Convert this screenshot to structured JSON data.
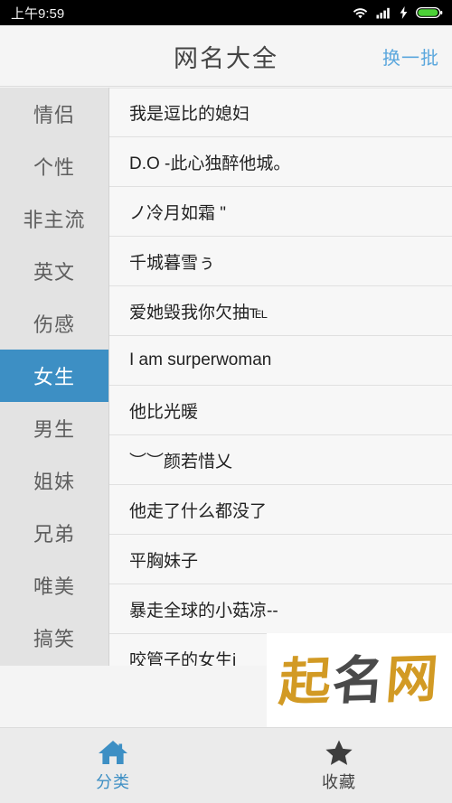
{
  "statusbar": {
    "time": "上午9:59",
    "icons": [
      "wifi-icon",
      "cellular-signal-icon",
      "charging-bolt-icon",
      "battery-icon"
    ],
    "battery_color": "#4cd137",
    "background": "#000000"
  },
  "header": {
    "title": "网名大全",
    "action_label": "换一批",
    "action_color": "#5ba7dd",
    "background": "#f5f5f5"
  },
  "sidebar": {
    "active_index": 5,
    "active_color": "#3d8fc4",
    "background": "#e3e3e3",
    "items": [
      {
        "label": "情侣"
      },
      {
        "label": "个性"
      },
      {
        "label": "非主流"
      },
      {
        "label": "英文"
      },
      {
        "label": "伤感"
      },
      {
        "label": "女生"
      },
      {
        "label": "男生"
      },
      {
        "label": "姐妹"
      },
      {
        "label": "兄弟"
      },
      {
        "label": "唯美"
      },
      {
        "label": "搞笑"
      }
    ]
  },
  "list": {
    "items": [
      {
        "name": "我是逗比的媳妇"
      },
      {
        "name": "D.O -此心独醉他城。"
      },
      {
        "name": "ノ冷月如霜 \""
      },
      {
        "name": "千城暮雪ぅ"
      },
      {
        "name": "爱她毁我你欠抽℡"
      },
      {
        "name": "I am surperwoman"
      },
      {
        "name": "他比光暖"
      },
      {
        "name": "︶︶颜若惜乂"
      },
      {
        "name": "他走了什么都没了"
      },
      {
        "name": "平胸妹子"
      },
      {
        "name": "暴走全球的小菇凉--"
      },
      {
        "name": "咬管子的女生i"
      }
    ]
  },
  "watermark": {
    "char1": "起",
    "char2": "名",
    "char3": "网",
    "color_gold": "#d29a24",
    "color_dark": "#4a4a4a"
  },
  "bottomnav": {
    "active_index": 0,
    "items": [
      {
        "label": "分类",
        "icon": "home-icon"
      },
      {
        "label": "收藏",
        "icon": "star-icon"
      }
    ]
  }
}
